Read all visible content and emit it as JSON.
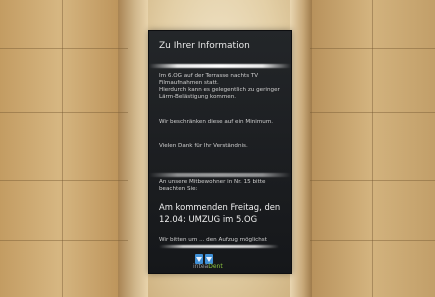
{
  "sign": {
    "title": "Zu Ihrer Information",
    "paragraph1": "Im 6.OG auf der Terrasse nachts TV Filmaufnahmen statt.\nHierdurch kann es gelegentlich zu geringer Lärm-Belästigung kommen.",
    "paragraph2": "Wir beschränken diese auf ein Minimum.",
    "paragraph3": "Vielen Dank für Ihr Verständnis.",
    "paragraph4": "An unsere Mitbewohner in Nr. 15 bitte beachten Sie:",
    "headline": "Am kommenden Freitag, den 12.04: UMZUG im 5.OG",
    "paragraph5": "Wir bitten um ... den Aufzug möglichst",
    "brand_prefix": "intea",
    "brand_suffix": "Dent"
  },
  "colors": {
    "panel": "#1b1d20",
    "wall": "#c9a46e",
    "brand_accent": "#8dc63f",
    "icon_blue": "#3f8fd6"
  }
}
